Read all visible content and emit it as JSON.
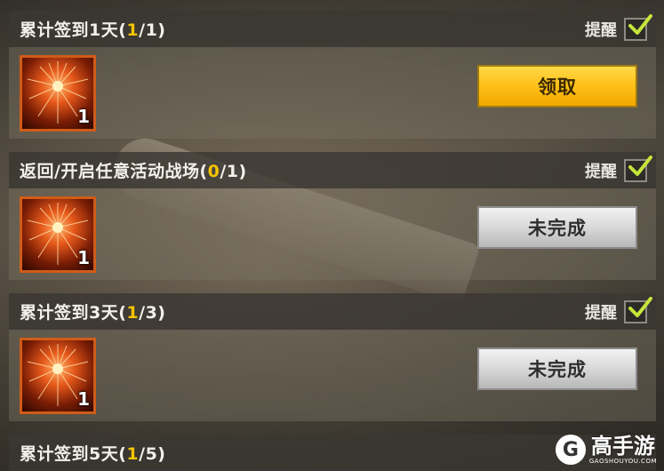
{
  "colors": {
    "progress_accent": "#f5c400",
    "claim_button": "#ffc21a",
    "incomplete_button": "#d8d8d8",
    "check_color": "#c6e63a",
    "reward_border": "#d05c18"
  },
  "quests": [
    {
      "title_prefix": "累计签到1天(",
      "progress_current": "1",
      "progress_suffix": "/1)",
      "remind_label": "提醒",
      "remind_checked": true,
      "reward": {
        "icon": "firework-icon",
        "count": "1"
      },
      "button": {
        "label": "领取",
        "state": "claim"
      }
    },
    {
      "title_prefix": "返回/开启任意活动战场(",
      "progress_current": "0",
      "progress_suffix": "/1)",
      "remind_label": "提醒",
      "remind_checked": true,
      "reward": {
        "icon": "firework-icon",
        "count": "1"
      },
      "button": {
        "label": "未完成",
        "state": "incomplete"
      }
    },
    {
      "title_prefix": "累计签到3天(",
      "progress_current": "1",
      "progress_suffix": "/3)",
      "remind_label": "提醒",
      "remind_checked": true,
      "reward": {
        "icon": "firework-icon",
        "count": "1"
      },
      "button": {
        "label": "未完成",
        "state": "incomplete"
      }
    },
    {
      "title_prefix": "累计签到5天(",
      "progress_current": "1",
      "progress_suffix": "/5)"
    }
  ],
  "watermark": {
    "logo": "G",
    "main": "高手游",
    "sub": "GAOSHOUYOU.COM"
  }
}
